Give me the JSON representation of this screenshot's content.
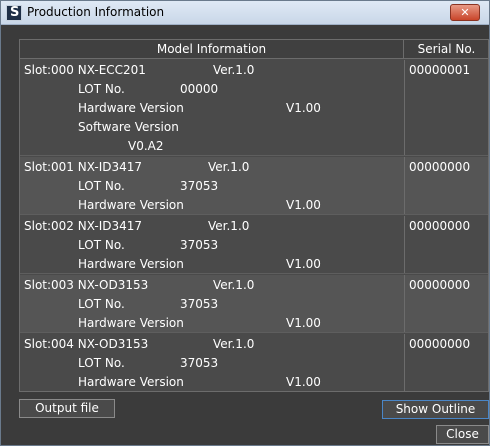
{
  "window": {
    "title": "Production Information",
    "close_glyph": "✕"
  },
  "table": {
    "headers": {
      "model": "Model Information",
      "serial": "Serial No."
    },
    "slots": [
      {
        "slot": "Slot:000 NX-ECC201",
        "ver": "Ver.1.0",
        "lot_label": "LOT No.",
        "lot": "00000",
        "hw_label": "Hardware Version",
        "hw": "V1.00",
        "sw_label": "Software Version",
        "sw": "V0.A2",
        "serial": "00000001"
      },
      {
        "slot": "Slot:001 NX-ID3417",
        "ver": "Ver.1.0",
        "lot_label": "LOT No.",
        "lot": "37053",
        "hw_label": "Hardware Version",
        "hw": "V1.00",
        "serial": "00000000"
      },
      {
        "slot": "Slot:002 NX-ID3417",
        "ver": "Ver.1.0",
        "lot_label": "LOT No.",
        "lot": "37053",
        "hw_label": "Hardware Version",
        "hw": "V1.00",
        "serial": "00000000"
      },
      {
        "slot": "Slot:003 NX-OD3153",
        "ver": "Ver.1.0",
        "lot_label": "LOT No.",
        "lot": "37053",
        "hw_label": "Hardware Version",
        "hw": "V1.00",
        "serial": "00000000"
      },
      {
        "slot": "Slot:004 NX-OD3153",
        "ver": "Ver.1.0",
        "lot_label": "LOT No.",
        "lot": "37053",
        "hw_label": "Hardware Version",
        "hw": "V1.00",
        "serial": "00000000"
      }
    ]
  },
  "buttons": {
    "output_file": "Output file",
    "show_outline": "Show Outline",
    "close": "Close"
  }
}
